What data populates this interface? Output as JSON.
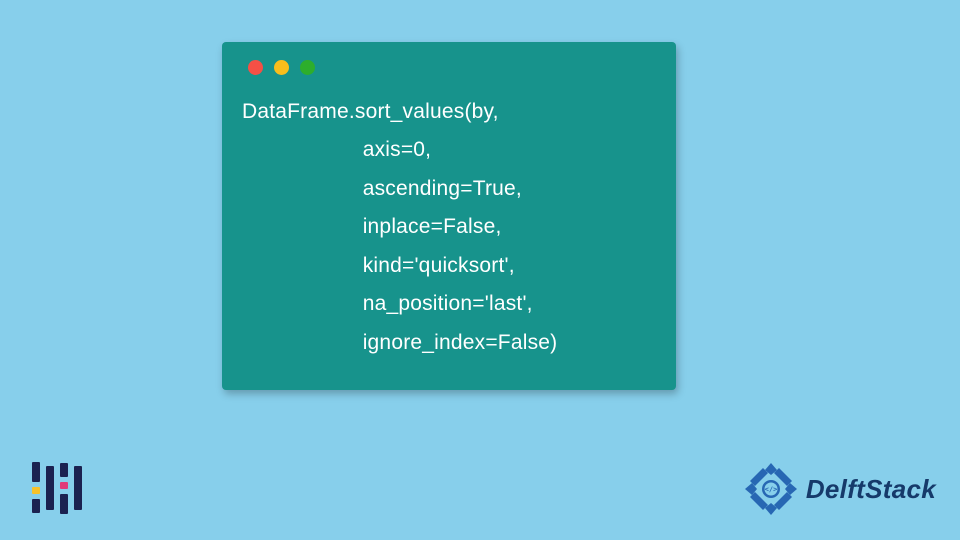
{
  "code": {
    "lines": [
      "DataFrame.sort_values(by,",
      "                    axis=0,",
      "                    ascending=True,",
      "                    inplace=False,",
      "                    kind='quicksort',",
      "                    na_position='last',",
      "                    ignore_index=False)"
    ]
  },
  "window": {
    "dots": [
      "red",
      "yellow",
      "green"
    ]
  },
  "brand": {
    "name": "DelftStack"
  },
  "colors": {
    "background": "#87cfeb",
    "window": "#17938c",
    "brand_text": "#163a6a",
    "left_logo_navy": "#1b2250",
    "left_logo_yellow": "#f6c22b",
    "left_logo_pink": "#e03b7a",
    "brand_icon": "#2767b3"
  }
}
